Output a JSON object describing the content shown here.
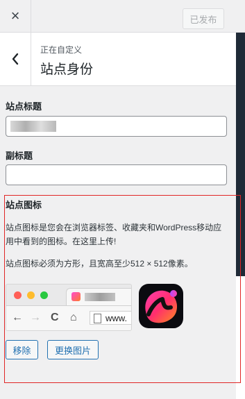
{
  "topbar": {
    "close_glyph": "×",
    "publish_label": "已发布"
  },
  "section": {
    "back_glyph": "‹",
    "breadcrumb": "正在自定义",
    "title": "站点身份"
  },
  "fields": {
    "site_title_label": "站点标题",
    "site_title_value": "",
    "tagline_label": "副标题",
    "tagline_value": ""
  },
  "site_icon": {
    "heading": "站点图标",
    "description": "站点图标是您会在浏览器标签、收藏夹和WordPress移动应用中看到的图标。在这里上传!",
    "requirement": "站点图标必须为方形，且宽高至少512 × 512像素。",
    "preview": {
      "address_text": "www.",
      "nav_back": "←",
      "nav_forward": "→",
      "reload": "C",
      "home": "⌂"
    },
    "remove_label": "移除",
    "change_label": "更换图片"
  },
  "colors": {
    "accent": "#2271b1",
    "highlight_border": "#e02525",
    "dark_preview": "#1f2a37"
  }
}
